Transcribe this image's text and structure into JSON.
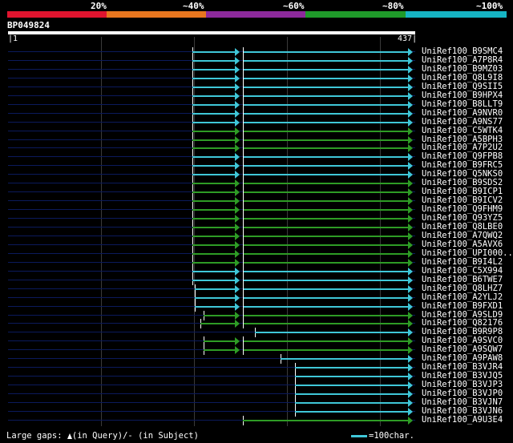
{
  "identity_scale": {
    "labels": [
      "20%",
      "~40%",
      "~60%",
      "~80%",
      "~100%"
    ],
    "colors": [
      "#e0142f",
      "#e8761f",
      "#8d2a9c",
      "#1f9a2a",
      "#16b4c4"
    ]
  },
  "query": {
    "name": "BP049824",
    "start": "1",
    "end": "437"
  },
  "colors": {
    "cyan": "#3fc7d8",
    "green": "#2e9c25",
    "navy": "#0b1a5c"
  },
  "hits": [
    {
      "label": "UniRef100_B9SMC4",
      "color": "cyan",
      "split": true
    },
    {
      "label": "UniRef100_A7P8R4",
      "color": "cyan",
      "split": true
    },
    {
      "label": "UniRef100_B9MZ03",
      "color": "cyan",
      "split": true
    },
    {
      "label": "UniRef100_Q8L9I8",
      "color": "cyan",
      "split": true
    },
    {
      "label": "UniRef100_Q9SII5",
      "color": "cyan",
      "split": true
    },
    {
      "label": "UniRef100_B9HPX4",
      "color": "cyan",
      "split": true
    },
    {
      "label": "UniRef100_B8LLT9",
      "color": "cyan",
      "split": true
    },
    {
      "label": "UniRef100_A9NVR0",
      "color": "cyan",
      "split": true
    },
    {
      "label": "UniRef100_A9NS77",
      "color": "cyan",
      "split": true
    },
    {
      "label": "UniRef100_C5WTK4",
      "color": "green",
      "split": true
    },
    {
      "label": "UniRef100_A5BPH3",
      "color": "green",
      "split": true
    },
    {
      "label": "UniRef100_A7P2U2",
      "color": "green",
      "split": true
    },
    {
      "label": "UniRef100_Q9FPB8",
      "color": "cyan",
      "split": true
    },
    {
      "label": "UniRef100_B9FRC5",
      "color": "cyan",
      "split": true
    },
    {
      "label": "UniRef100_Q5NKS0",
      "color": "cyan",
      "split": true
    },
    {
      "label": "UniRef100_B9SDS2",
      "color": "green",
      "split": true
    },
    {
      "label": "UniRef100_B9ICP1",
      "color": "green",
      "split": true
    },
    {
      "label": "UniRef100_B9ICV2",
      "color": "green",
      "split": true
    },
    {
      "label": "UniRef100_Q9FHM9",
      "color": "green",
      "split": true
    },
    {
      "label": "UniRef100_Q93YZ5",
      "color": "green",
      "split": true
    },
    {
      "label": "UniRef100_Q8LBE0",
      "color": "green",
      "split": true
    },
    {
      "label": "UniRef100_A7QWQ2",
      "color": "green",
      "split": true
    },
    {
      "label": "UniRef100_A5AVX6",
      "color": "green",
      "split": true
    },
    {
      "label": "UniRef100_UPI000..",
      "color": "green",
      "split": true
    },
    {
      "label": "UniRef100_B9I4L2",
      "color": "green",
      "split": true
    },
    {
      "label": "UniRef100_C5X994",
      "color": "cyan",
      "split": true
    },
    {
      "label": "UniRef100_B6TWE7",
      "color": "cyan",
      "split": true
    },
    {
      "label": "UniRef100_Q8LHZ7",
      "color": "cyan",
      "split": true
    },
    {
      "label": "UniRef100_A2YLJ2",
      "color": "cyan",
      "split": true
    },
    {
      "label": "UniRef100_B9FXD1",
      "color": "cyan",
      "split": true
    },
    {
      "label": "UniRef100_A9SLD9",
      "color": "green",
      "split": true
    },
    {
      "label": "UniRef100_Q82176",
      "color": "green",
      "split": true
    },
    {
      "label": "UniRef100_B9R9P8",
      "color": "cyan",
      "split": false
    },
    {
      "label": "UniRef100_A9SVC0",
      "color": "green",
      "split": true
    },
    {
      "label": "UniRef100_A9SQW7",
      "color": "green",
      "split": true
    },
    {
      "label": "UniRef100_A9PAW8",
      "color": "cyan",
      "split": false
    },
    {
      "label": "UniRef100_B3VJR4",
      "color": "cyan",
      "split": false
    },
    {
      "label": "UniRef100_B3VJQ5",
      "color": "cyan",
      "split": false
    },
    {
      "label": "UniRef100_B3VJP3",
      "color": "cyan",
      "split": false
    },
    {
      "label": "UniRef100_B3VJP0",
      "color": "cyan",
      "split": false
    },
    {
      "label": "UniRef100_B3VJN7",
      "color": "cyan",
      "split": false
    },
    {
      "label": "UniRef100_B3VJN6",
      "color": "cyan",
      "split": false
    },
    {
      "label": "UniRef100_A9U3E4",
      "color": "green",
      "split": false
    }
  ],
  "footer": {
    "gaps_prefix": "Large gaps:",
    "gaps_query": "(in Query)/",
    "gaps_subject_glyph": "-",
    "gaps_subject": "(in Subject)",
    "legend_text": "=100char."
  }
}
